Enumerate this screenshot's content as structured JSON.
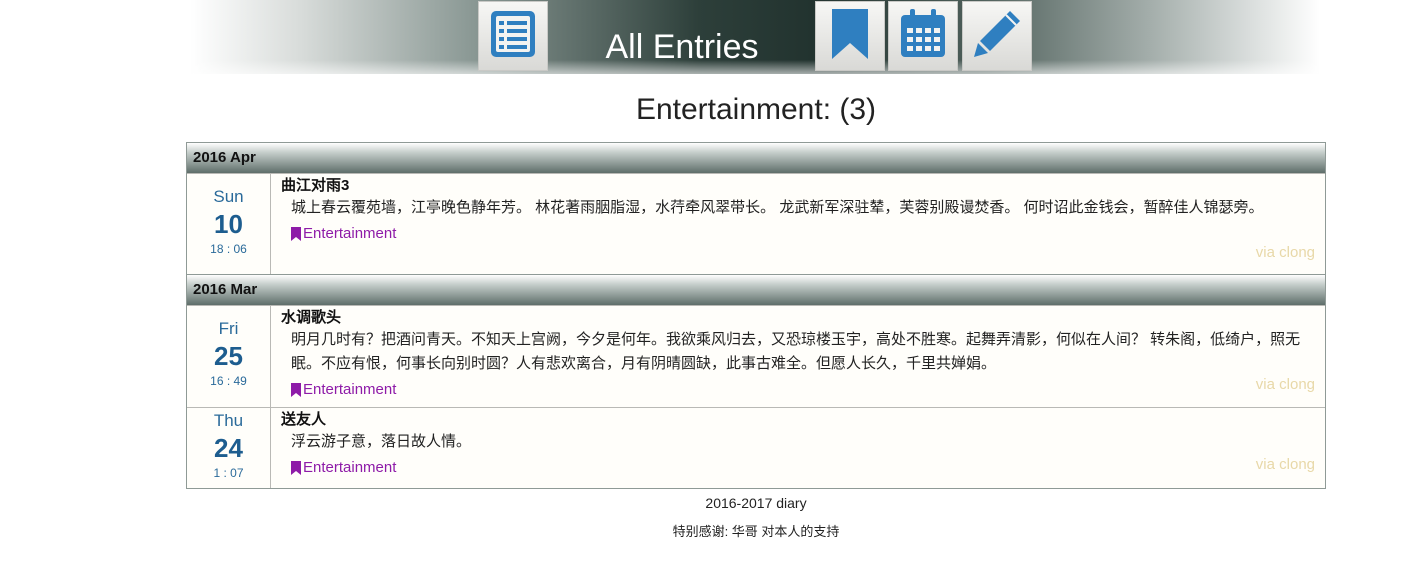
{
  "header": {
    "title": "All Entries",
    "buttons": [
      "list-icon",
      "bookmark-icon",
      "calendar-icon",
      "pencil-icon"
    ],
    "icon_color": "#2f7fc0"
  },
  "category_title": "Entertainment: (3)",
  "groups": [
    {
      "month": "2016 Apr",
      "entries": [
        {
          "dow": "Sun",
          "day": "10",
          "time": "18 : 06",
          "title": "曲江对雨3",
          "text": "城上春云覆苑墙，江亭晚色静年芳。 林花著雨胭脂湿，水荇牵风翠带长。 龙武新军深驻辇，芙蓉别殿谩焚香。 何时诏此金钱会，暂醉佳人锦瑟旁。",
          "tag": "Entertainment",
          "via": "via clong"
        }
      ]
    },
    {
      "month": "2016 Mar",
      "entries": [
        {
          "dow": "Fri",
          "day": "25",
          "time": "16 : 49",
          "title": "水调歌头",
          "text": "明月几时有？把酒问青天。不知天上宫阙，今夕是何年。我欲乘风归去，又恐琼楼玉宇，高处不胜寒。起舞弄清影，何似在人间？ 转朱阁，低绮户，照无眠。不应有恨，何事长向别时圆？人有悲欢离合，月有阴晴圆缺，此事古难全。但愿人长久，千里共婵娟。",
          "tag": "Entertainment",
          "via": "via clong"
        },
        {
          "dow": "Thu",
          "day": "24",
          "time": "1 : 07",
          "title": "送友人",
          "text": "浮云游子意，落日故人情。",
          "tag": "Entertainment",
          "via": "via clong"
        }
      ]
    }
  ],
  "footer": {
    "line1": "2016-2017 diary",
    "line2": "特别感谢: 华哥 对本人的支持"
  },
  "colors": {
    "tag": "#8e1ba8",
    "date": "#1d5d8f",
    "via": "#e8d8a8"
  }
}
